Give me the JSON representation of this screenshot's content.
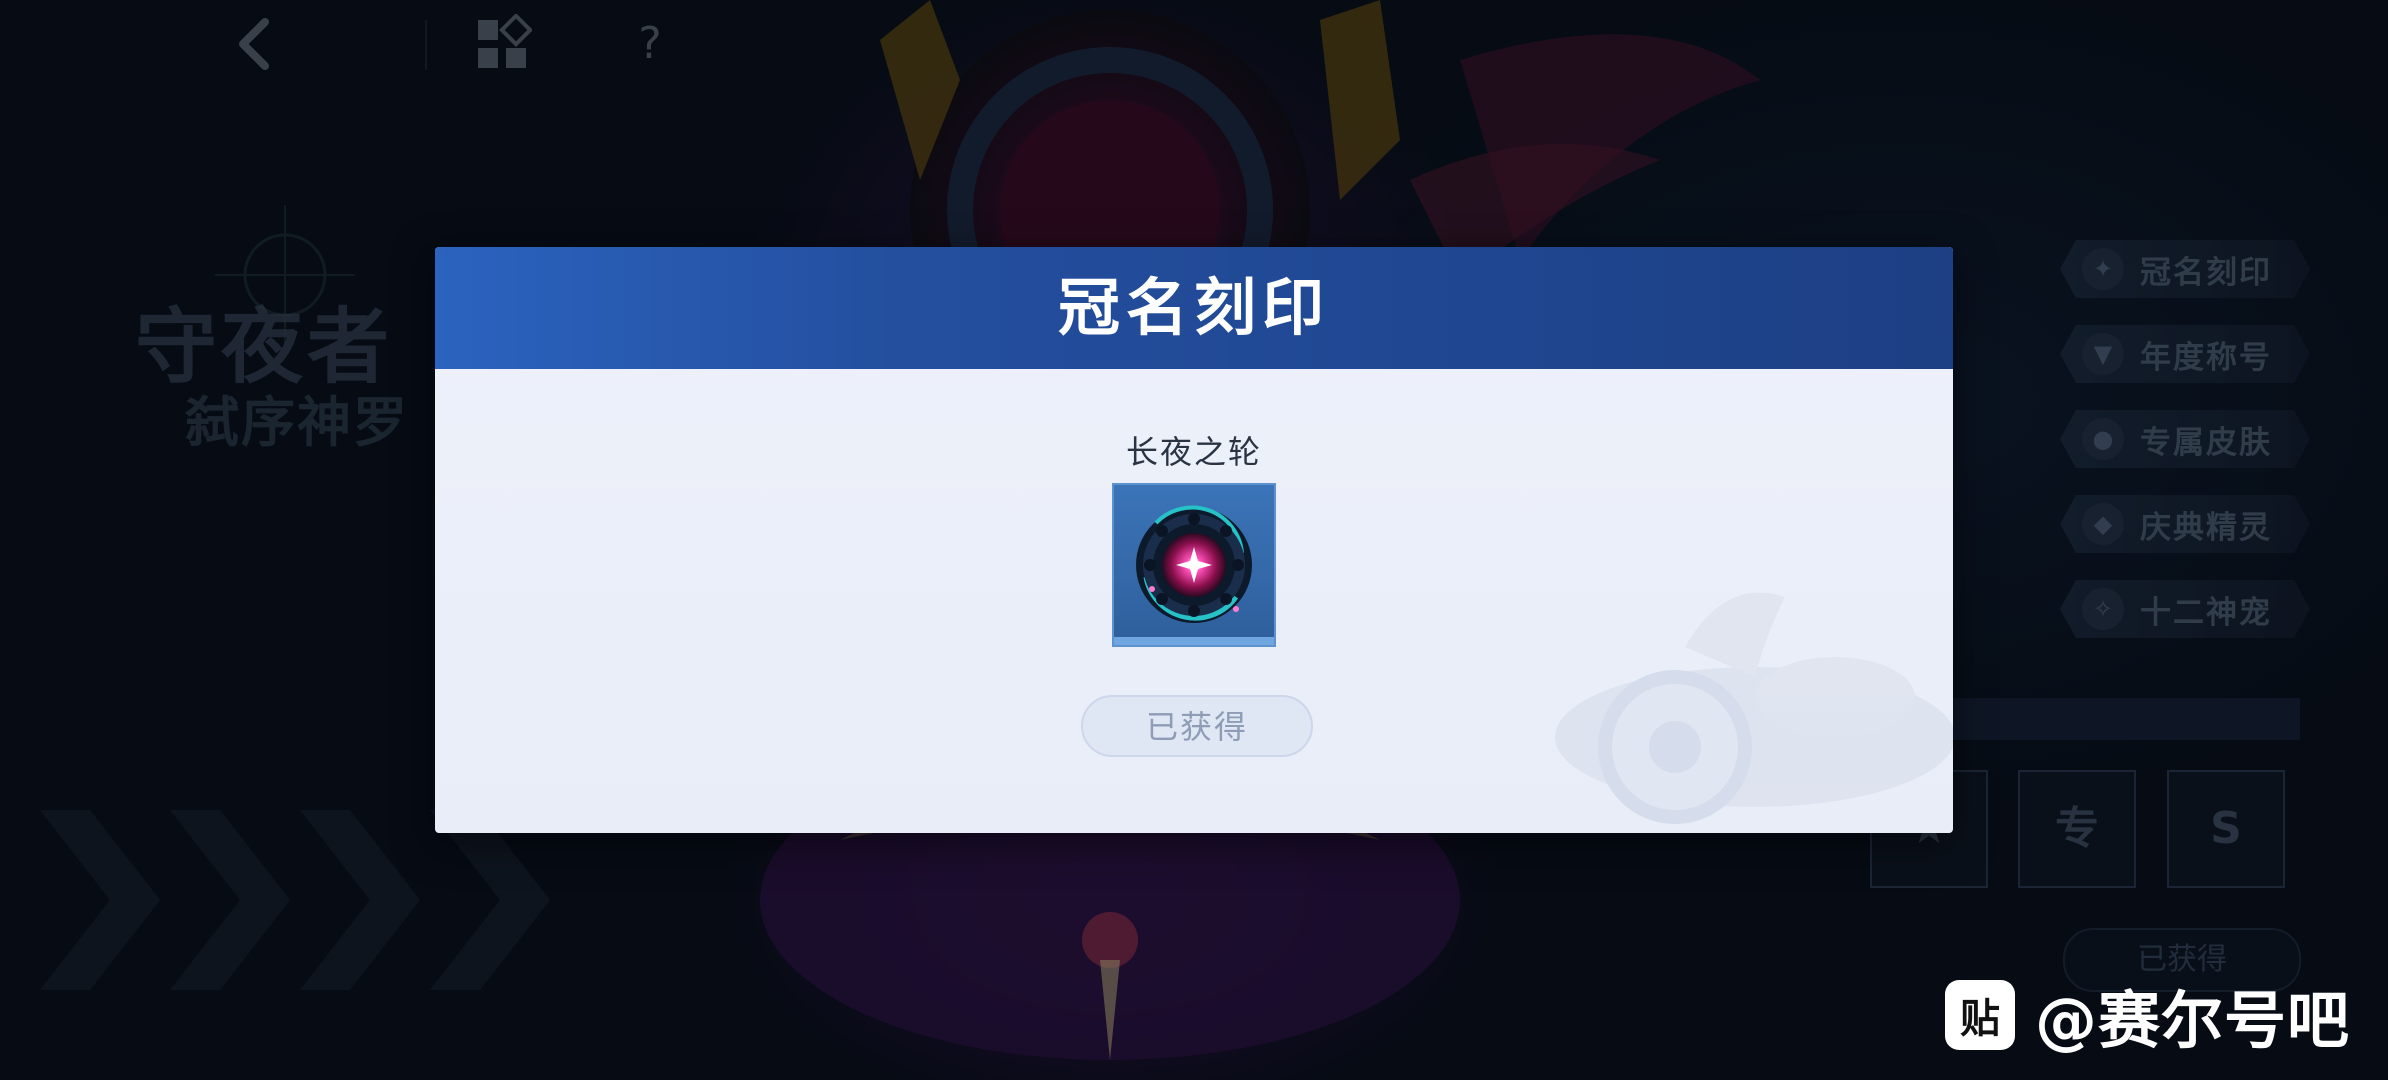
{
  "background": {
    "hero_name": "守夜者",
    "hero_subtitle": "弑序神罗",
    "help_symbol": "?",
    "side_menu": [
      {
        "label": "冠名刻印",
        "icon": "emblem-icon"
      },
      {
        "label": "年度称号",
        "icon": "title-shield-icon"
      },
      {
        "label": "专属皮肤",
        "icon": "skin-icon"
      },
      {
        "label": "庆典精灵",
        "icon": "spirit-icon"
      },
      {
        "label": "十二神宠",
        "icon": "zodiac-pet-icon"
      }
    ],
    "badges": [
      {
        "glyph": "★",
        "icon": "star-badge-icon"
      },
      {
        "glyph": "专",
        "icon": "exclusive-badge-icon"
      },
      {
        "glyph": "S",
        "icon": "s-rank-badge-icon"
      }
    ],
    "owned_label": "已获得"
  },
  "modal": {
    "title": "冠名刻印",
    "item_name": "长夜之轮",
    "owned_label": "已获得"
  },
  "source": {
    "logo_glyph": "贴",
    "handle": "@赛尔号吧"
  },
  "colors": {
    "header_blue": "#244f9f",
    "modal_bg": "#eef1fa",
    "item_frame": "#3b74b8"
  }
}
